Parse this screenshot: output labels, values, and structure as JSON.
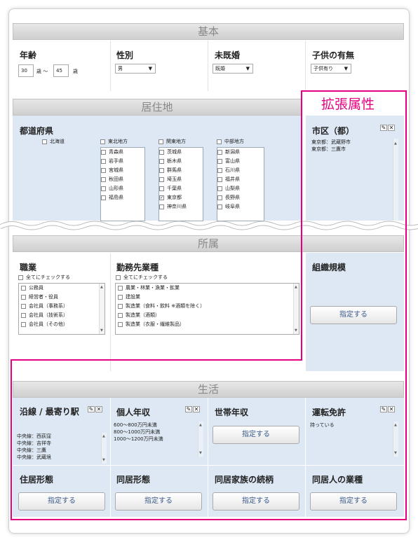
{
  "colors": {
    "accent": "#e4007f",
    "section_blue": "#dde8f4",
    "header_gray": "#d6d6d6"
  },
  "kihon": {
    "header": "基本",
    "age": {
      "label": "年齢",
      "from": "30",
      "mid": "歳 〜",
      "to": "45",
      "unit": "歳"
    },
    "gender": {
      "label": "性別",
      "value": "男"
    },
    "married": {
      "label": "未既婚",
      "value": "既婚"
    },
    "children": {
      "label": "子供の有無",
      "value": "子供有り"
    }
  },
  "kyojuchi": {
    "header": "居住地",
    "pref_label": "都道府県",
    "hokkaido": "北海道",
    "regions": [
      {
        "name": "東北地方",
        "prefs": [
          "青森県",
          "岩手県",
          "宮城県",
          "秋田県",
          "山形県",
          "福島県"
        ]
      },
      {
        "name": "関東地方",
        "prefs": [
          "茨城県",
          "栃木県",
          "群馬県",
          "埼玉県",
          "千葉県",
          "東京都",
          "神奈川県"
        ]
      },
      {
        "name": "中部地方",
        "prefs": [
          "新潟県",
          "富山県",
          "石川県",
          "福井県",
          "山梨県",
          "長野県",
          "岐阜県"
        ]
      }
    ]
  },
  "extended": {
    "title": "拡張属性",
    "city_label": "市区（都）",
    "cities": [
      "東京都：武蔵野市",
      "東京都：三鷹市"
    ]
  },
  "shozoku": {
    "header": "所属",
    "job_label": "職業",
    "check_all": "全てにチェックする",
    "jobs": [
      "公務員",
      "経営者・役員",
      "会社員（事務系）",
      "会社員（技術系）",
      "会社員（その他）"
    ],
    "industry_label": "勤務先業種",
    "industries": [
      "農業・林業・漁業・鉱業",
      "建設業",
      "製造業（食料・飲料 ※酒類を除く）",
      "製造業（酒類）",
      "製造業（衣服・繊維製品）"
    ],
    "org_label": "組織規模",
    "org_button": "指定する"
  },
  "seikatsu": {
    "header": "生活",
    "line_label": "沿線 / 最寄り駅",
    "stations": [
      "中央線：西荻窪",
      "中央線：吉祥寺",
      "中央線：三鷹",
      "中央線：武蔵境"
    ],
    "income_label": "個人年収",
    "incomes": [
      "600〜800万円未満",
      "800〜1000万円未満",
      "1000〜1200万円未満"
    ],
    "household_label": "世帯年収",
    "household_button": "指定する",
    "license_label": "運転免許",
    "license_value": "持っている",
    "housing_label": "住居形態",
    "housing_button": "指定する",
    "cohabit_label": "同居形態",
    "cohabit_button": "指定する",
    "family_label": "同居家族の続柄",
    "family_button": "指定する",
    "cohabit_job_label": "同居人の業種",
    "cohabit_job_button": "指定する"
  }
}
